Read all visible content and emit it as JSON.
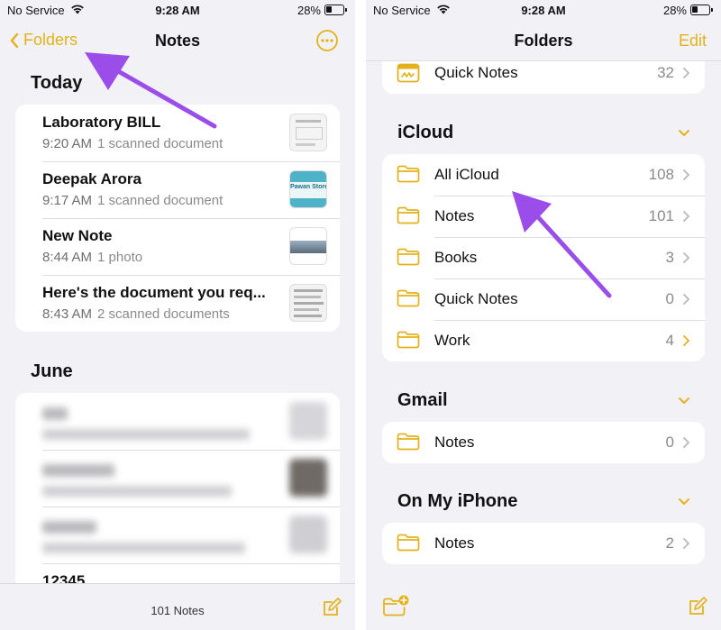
{
  "colors": {
    "accent": "#e3b21a",
    "arrow": "#9b4dea",
    "background": "#f2f1f6"
  },
  "left": {
    "status": {
      "carrier": "No Service",
      "time": "9:28 AM",
      "battery": "28%"
    },
    "nav": {
      "back_label": "Folders",
      "title": "Notes",
      "more_icon": "ellipsis-circle-icon"
    },
    "sections": [
      {
        "title": "Today",
        "notes": [
          {
            "title": "Laboratory BILL",
            "time": "9:20 AM",
            "detail": "1 scanned document"
          },
          {
            "title": "Deepak Arora",
            "time": "9:17 AM",
            "detail": "1 scanned document"
          },
          {
            "title": "New Note",
            "time": "8:44 AM",
            "detail": "1 photo"
          },
          {
            "title": "Here's the document you req...",
            "time": "8:43 AM",
            "detail": "2 scanned documents"
          }
        ]
      },
      {
        "title": "June",
        "partial_note_title": "12345"
      }
    ],
    "thumb_text": "Pawan Store",
    "bottom": {
      "count": "101 Notes",
      "compose_icon": "compose-icon"
    }
  },
  "right": {
    "status": {
      "carrier": "No Service",
      "time": "9:28 AM",
      "battery": "28%"
    },
    "nav": {
      "title": "Folders",
      "edit_label": "Edit"
    },
    "top_folder": {
      "name": "Quick Notes",
      "count": "32"
    },
    "groups": [
      {
        "title": "iCloud",
        "folders": [
          {
            "name": "All iCloud",
            "count": "108"
          },
          {
            "name": "Notes",
            "count": "101"
          },
          {
            "name": "Books",
            "count": "3"
          },
          {
            "name": "Quick Notes",
            "count": "0"
          },
          {
            "name": "Work",
            "count": "4"
          }
        ]
      },
      {
        "title": "Gmail",
        "folders": [
          {
            "name": "Notes",
            "count": "0"
          }
        ]
      },
      {
        "title": "On My iPhone",
        "folders": [
          {
            "name": "Notes",
            "count": "2"
          }
        ]
      }
    ],
    "bottom": {
      "new_folder_icon": "new-folder-icon",
      "compose_icon": "compose-icon"
    }
  }
}
